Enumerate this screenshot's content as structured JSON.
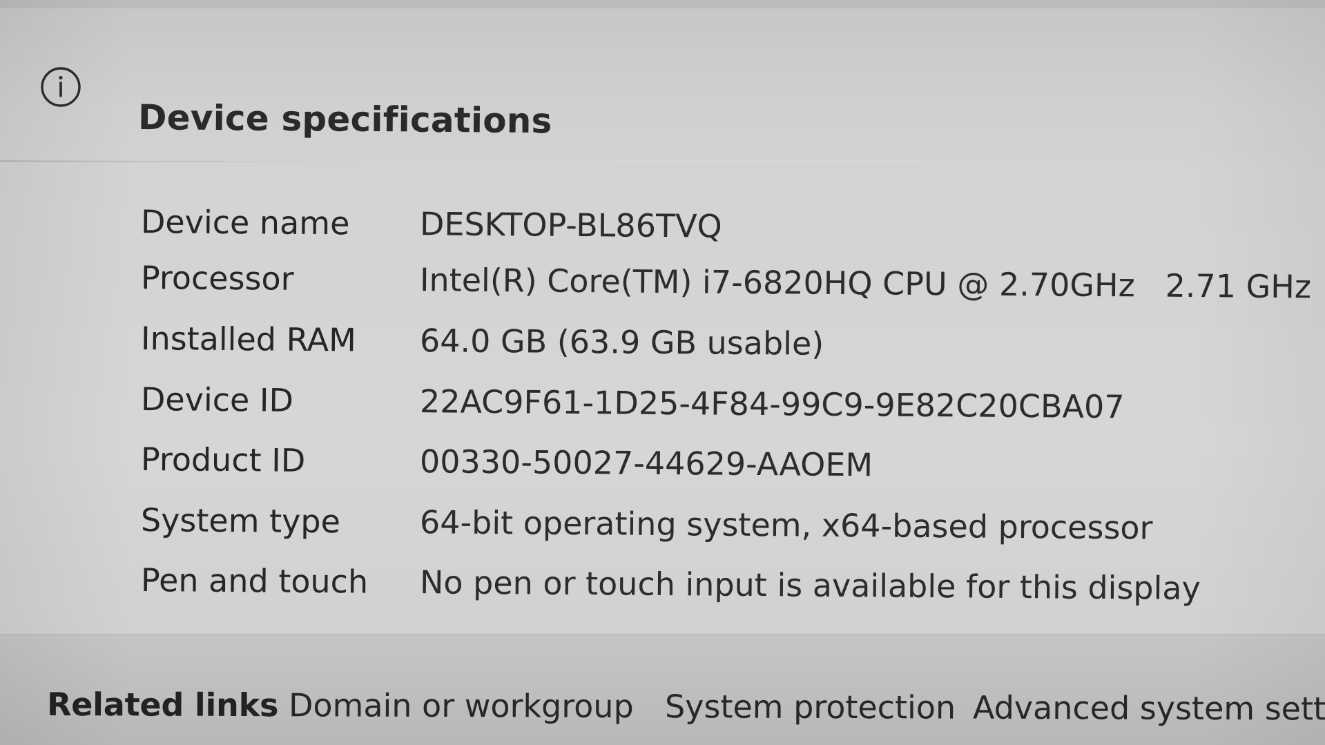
{
  "header": {
    "icon": "info-icon",
    "title": "Device specifications"
  },
  "specs": [
    {
      "label": "Device name",
      "value": "DESKTOP-BL86TVQ"
    },
    {
      "label": "Processor",
      "value": "Intel(R) Core(TM) i7-6820HQ CPU @ 2.70GHz   2.71 GHz"
    },
    {
      "label": "Installed RAM",
      "value": "64.0 GB (63.9 GB usable)"
    },
    {
      "label": "Device ID",
      "value": "22AC9F61-1D25-4F84-99C9-9E82C20CBA07"
    },
    {
      "label": "Product ID",
      "value": "00330-50027-44629-AAOEM"
    },
    {
      "label": "System type",
      "value": "64-bit operating system, x64-based processor"
    },
    {
      "label": "Pen and touch",
      "value": "No pen or touch input is available for this display"
    }
  ],
  "related_links": {
    "title": "Related links",
    "items": [
      {
        "label": "Domain or workgroup"
      },
      {
        "label": "System protection"
      },
      {
        "label": "Advanced system settings"
      }
    ]
  },
  "colors": {
    "panel": "#d3d3d3",
    "footer": "#c4c4c4",
    "text": "#2b2b2b"
  }
}
